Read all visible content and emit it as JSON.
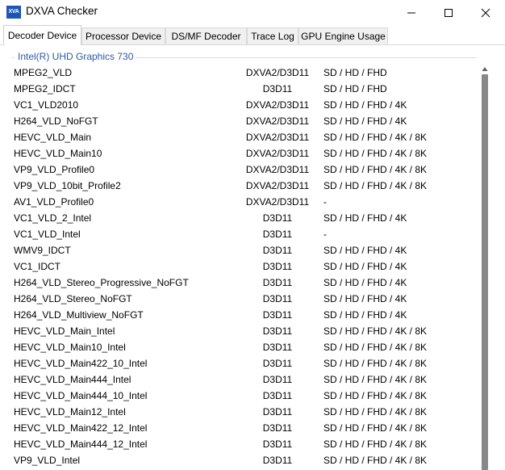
{
  "window": {
    "title": "DXVA Checker",
    "icon_label": "XVA"
  },
  "tabs": [
    "Decoder Device",
    "Processor Device",
    "DS/MF Decoder",
    "Trace Log",
    "GPU Engine Usage"
  ],
  "group": {
    "title": "Intel(R) UHD Graphics 730"
  },
  "rows": [
    [
      "MPEG2_VLD",
      "DXVA2/D3D11",
      "SD / HD / FHD"
    ],
    [
      "MPEG2_IDCT",
      "D3D11",
      "SD / HD / FHD"
    ],
    [
      "VC1_VLD2010",
      "DXVA2/D3D11",
      "SD / HD / FHD / 4K"
    ],
    [
      "H264_VLD_NoFGT",
      "DXVA2/D3D11",
      "SD / HD / FHD / 4K"
    ],
    [
      "HEVC_VLD_Main",
      "DXVA2/D3D11",
      "SD / HD / FHD / 4K / 8K"
    ],
    [
      "HEVC_VLD_Main10",
      "DXVA2/D3D11",
      "SD / HD / FHD / 4K / 8K"
    ],
    [
      "VP9_VLD_Profile0",
      "DXVA2/D3D11",
      "SD / HD / FHD / 4K / 8K"
    ],
    [
      "VP9_VLD_10bit_Profile2",
      "DXVA2/D3D11",
      "SD / HD / FHD / 4K / 8K"
    ],
    [
      "AV1_VLD_Profile0",
      "DXVA2/D3D11",
      "-"
    ],
    [
      "VC1_VLD_2_Intel",
      "D3D11",
      "SD / HD / FHD / 4K"
    ],
    [
      "VC1_VLD_Intel",
      "D3D11",
      "-"
    ],
    [
      "WMV9_IDCT",
      "D3D11",
      "SD / HD / FHD / 4K"
    ],
    [
      "VC1_IDCT",
      "D3D11",
      "SD / HD / FHD / 4K"
    ],
    [
      "H264_VLD_Stereo_Progressive_NoFGT",
      "D3D11",
      "SD / HD / FHD / 4K"
    ],
    [
      "H264_VLD_Stereo_NoFGT",
      "D3D11",
      "SD / HD / FHD / 4K"
    ],
    [
      "H264_VLD_Multiview_NoFGT",
      "D3D11",
      "SD / HD / FHD / 4K"
    ],
    [
      "HEVC_VLD_Main_Intel",
      "D3D11",
      "SD / HD / FHD / 4K / 8K"
    ],
    [
      "HEVC_VLD_Main10_Intel",
      "D3D11",
      "SD / HD / FHD / 4K / 8K"
    ],
    [
      "HEVC_VLD_Main422_10_Intel",
      "D3D11",
      "SD / HD / FHD / 4K / 8K"
    ],
    [
      "HEVC_VLD_Main444_Intel",
      "D3D11",
      "SD / HD / FHD / 4K / 8K"
    ],
    [
      "HEVC_VLD_Main444_10_Intel",
      "D3D11",
      "SD / HD / FHD / 4K / 8K"
    ],
    [
      "HEVC_VLD_Main12_Intel",
      "D3D11",
      "SD / HD / FHD / 4K / 8K"
    ],
    [
      "HEVC_VLD_Main422_12_Intel",
      "D3D11",
      "SD / HD / FHD / 4K / 8K"
    ],
    [
      "HEVC_VLD_Main444_12_Intel",
      "D3D11",
      "SD / HD / FHD / 4K / 8K"
    ],
    [
      "VP9_VLD_Intel",
      "D3D11",
      "SD / HD / FHD / 4K / 8K"
    ]
  ]
}
